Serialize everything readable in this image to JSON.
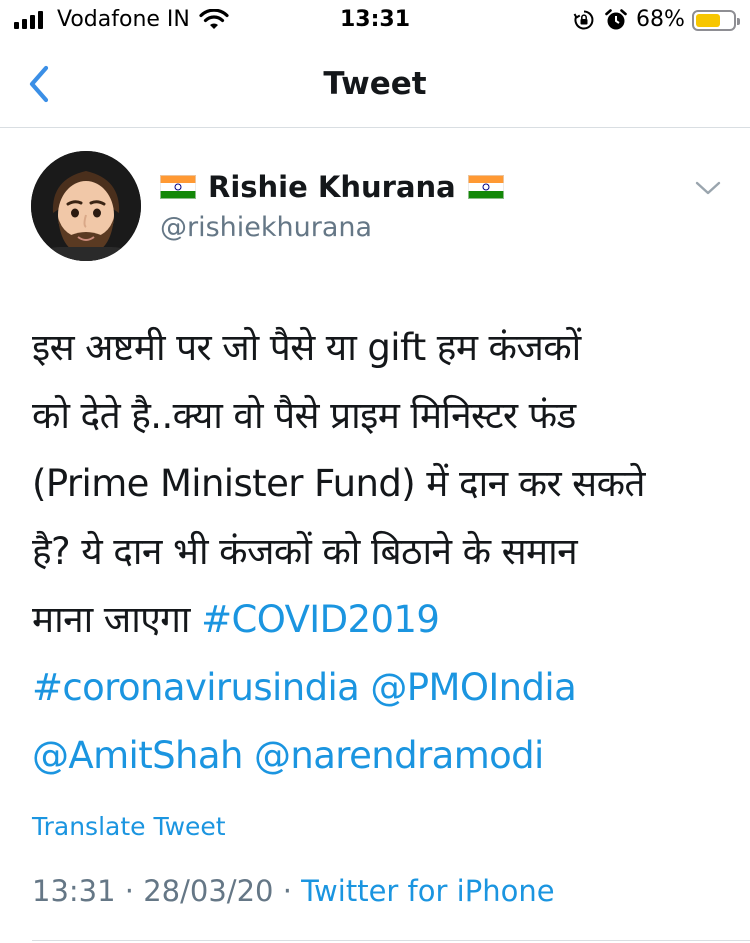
{
  "status_bar": {
    "carrier": "Vodafone IN",
    "time": "13:31",
    "battery_percent_label": "68%",
    "battery_level": 0.68,
    "icons": [
      "signal-icon",
      "wifi-icon",
      "orientation-lock-icon",
      "alarm-icon",
      "battery-icon"
    ]
  },
  "nav": {
    "title": "Tweet",
    "back_icon": "chevron-left-icon"
  },
  "tweet": {
    "display_name": "Rishie Khurana",
    "handle": "@rishiekhurana",
    "name_flag_icon": "india-flag-icon",
    "menu_icon": "chevron-down-icon",
    "text_lines": [
      "इस अष्टमी पर जो पैसे या gift हम कंजकों",
      "को देते है..क्या वो पैसे प्राइम मिनिस्टर फंड",
      "(Prime Minister Fund) में दान कर सकते",
      "है? ये दान भी कंजकों को बिठाने के समान"
    ],
    "line5_text": "माना जाएगा",
    "hashtag_covid": "#COVID2019",
    "hashtag_india": "#coronavirusindia",
    "mention_pmo": "@PMOIndia",
    "mention_amitshah": "@AmitShah",
    "mention_modi": "@narendramodi",
    "translate_label": "Translate Tweet",
    "time": "13:31",
    "date": "28/03/20",
    "separator": "·",
    "source": "Twitter for iPhone"
  },
  "colors": {
    "link": "#1b95e0",
    "text": "#14171a",
    "secondary": "#657786",
    "nav_blue": "#3b8fe6",
    "battery_fill": "#f7c600"
  }
}
